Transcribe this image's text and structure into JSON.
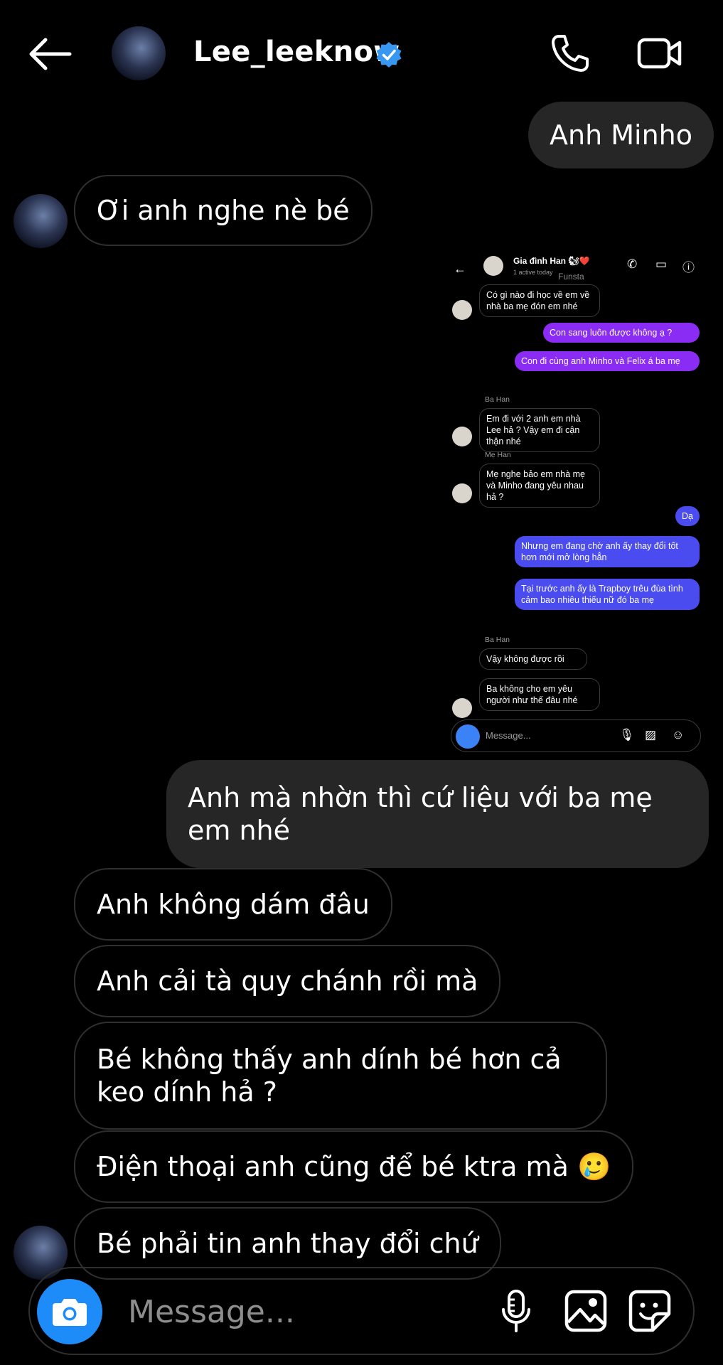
{
  "header": {
    "username": "Lee_leeknow",
    "verified": true,
    "icons": [
      "back-arrow-icon",
      "phone-icon",
      "video-camera-icon"
    ]
  },
  "messages": [
    {
      "side": "out",
      "text": "Anh Minho"
    },
    {
      "side": "in",
      "text": "Ơi anh nghe nè bé"
    },
    {
      "side": "out",
      "text": "Anh mà nhờn thì cứ liệu với ba mẹ em nhé"
    },
    {
      "side": "in",
      "text": "Anh không dám đâu"
    },
    {
      "side": "in",
      "text": "Anh cải tà quy chánh rồi mà"
    },
    {
      "side": "in",
      "text": "Bé không thấy anh dính bé hơn cả keo dính hả ?"
    },
    {
      "side": "in",
      "text": "Điện thoại anh cũng để bé ktra mà",
      "emoji": "🥲"
    },
    {
      "side": "in",
      "text": "Bé phải tin anh thay đổi chứ"
    }
  ],
  "shared_screenshot": {
    "title": "Gia đình Han",
    "title_emoji": "🐿❤️",
    "active": "1 active today",
    "funsta": "Funsta",
    "messages": [
      {
        "side": "in",
        "text": "Có gì nào đi học về em về nhà ba mẹ đón em nhé"
      },
      {
        "side": "out",
        "color": "purple",
        "text": "Con sang luôn được không ạ ?"
      },
      {
        "side": "out",
        "color": "purple",
        "text": "Con đi cùng anh Minho và Felix á ba mẹ"
      },
      {
        "side": "in",
        "sender": "Ba Han",
        "text": "Em đi với 2 anh em nhà Lee hả ? Vậy em đi cận thận nhé"
      },
      {
        "side": "in",
        "sender": "Mẹ Han",
        "text": "Mẹ nghe bảo em nhà mẹ và Minho đang yêu nhau hả ?"
      },
      {
        "side": "out",
        "color": "blue",
        "text": "Dạ"
      },
      {
        "side": "out",
        "color": "blue",
        "text": "Nhưng em đang chờ anh ấy thay đổi tốt hơn mới mở lòng hẳn"
      },
      {
        "side": "out",
        "color": "blue",
        "text": "Tại trước anh ấy là Trapboy trêu đùa tình cảm bao nhiêu thiếu nữ đó ba mẹ"
      },
      {
        "side": "in",
        "sender": "Ba Han",
        "text": "Vậy không được rồi"
      },
      {
        "side": "in",
        "text": "Ba không cho em yêu người như thế đâu nhé"
      }
    ],
    "input_placeholder": "Message..."
  },
  "composer": {
    "placeholder": "Message...",
    "icons": [
      "camera-icon",
      "microphone-icon",
      "gallery-icon",
      "sticker-icon"
    ]
  },
  "colors": {
    "background": "#000000",
    "outgoing_bubble": "#262626",
    "incoming_border": "#2f2f2f",
    "accent_blue": "#1d8cf8",
    "verified_blue": "#3897f0"
  }
}
